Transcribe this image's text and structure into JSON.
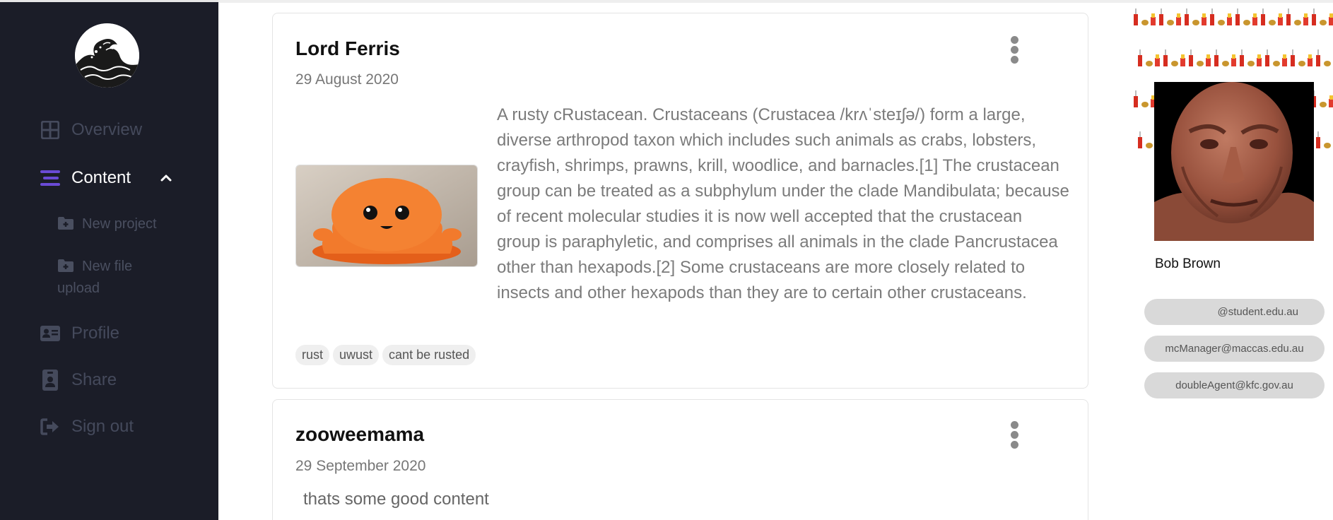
{
  "sidebar": {
    "items": [
      {
        "label": "Overview",
        "icon": "grid-icon"
      },
      {
        "label": "Content",
        "icon": "list-icon",
        "active": true
      },
      {
        "label": "Profile",
        "icon": "id-card-icon"
      },
      {
        "label": "Share",
        "icon": "badge-icon"
      },
      {
        "label": "Sign out",
        "icon": "sign-out-icon"
      }
    ],
    "subitems": [
      {
        "label": "New project",
        "icon": "folder-plus-icon"
      },
      {
        "label_line1": "New file",
        "label_line2": "upload",
        "icon": "folder-plus-icon"
      }
    ]
  },
  "posts": [
    {
      "author": "Lord Ferris",
      "date": "29 August 2020",
      "body": "A rusty cRustacean. Crustaceans (Crustacea /krʌˈsteɪʃə/) form a large, diverse arthropod taxon which includes such animals as crabs, lobsters, crayfish, shrimps, prawns, krill, woodlice, and barnacles.[1] The crustacean group can be treated as a subphylum under the clade Mandibulata; because of recent molecular studies it is now well accepted that the crustacean group is paraphyletic, and comprises all animals in the clade Pancrustacea other than hexapods.[2] Some crustaceans are more closely related to insects and other hexapods than they are to certain other crustaceans.",
      "tags": [
        "rust",
        "uwust",
        "cant be rusted"
      ]
    },
    {
      "author": "zooweemama",
      "date": "29 September 2020",
      "body": "thats some good content"
    }
  ],
  "profile": {
    "name": "Bob Brown",
    "emails": [
      "@student.edu.au",
      "mcManager@maccas.edu.au",
      "doubleAgent@kfc.gov.au"
    ]
  },
  "colors": {
    "sidebar_bg": "#1b1d28",
    "accent": "#6a4bd6",
    "muted_nav": "#454a5c"
  }
}
